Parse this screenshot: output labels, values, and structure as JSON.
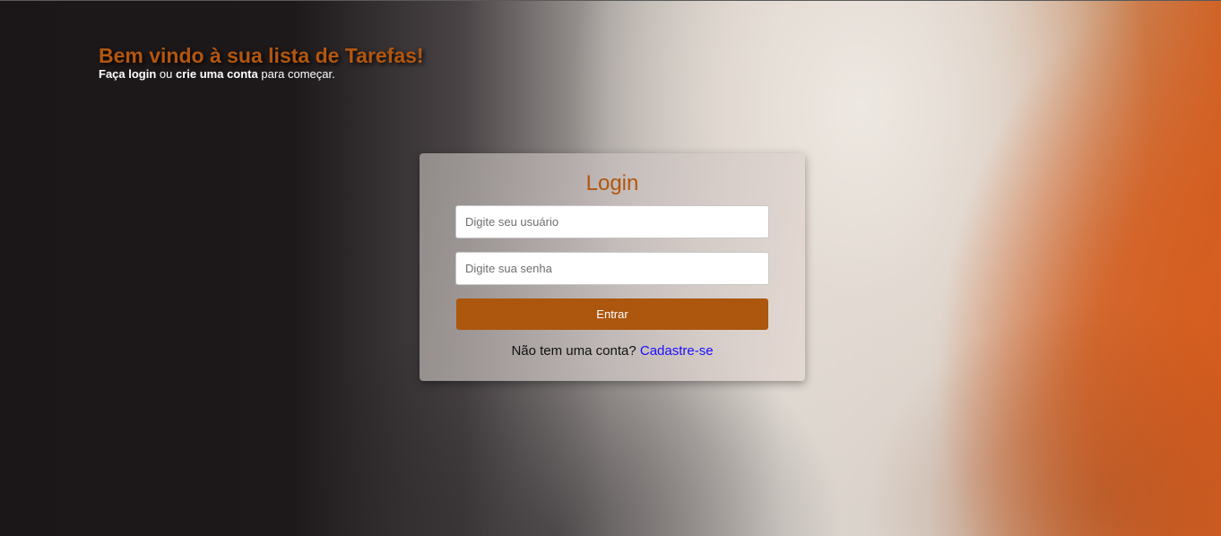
{
  "header": {
    "title": "Bem vindo à sua lista de Tarefas!",
    "subtitle_prefix": "Faça ",
    "subtitle_login": "login",
    "subtitle_middle": " ou ",
    "subtitle_create": "crie uma conta",
    "subtitle_suffix": " para começar."
  },
  "login_card": {
    "title": "Login",
    "username_placeholder": "Digite seu usuário",
    "username_value": "",
    "password_placeholder": "Digite sua senha",
    "password_value": "",
    "submit_label": "Entrar",
    "signup_prompt": "Não tem uma conta? ",
    "signup_link": "Cadastre-se"
  },
  "colors": {
    "accent": "#ac560e",
    "title": "#b2560f",
    "link": "#1a0dff"
  }
}
